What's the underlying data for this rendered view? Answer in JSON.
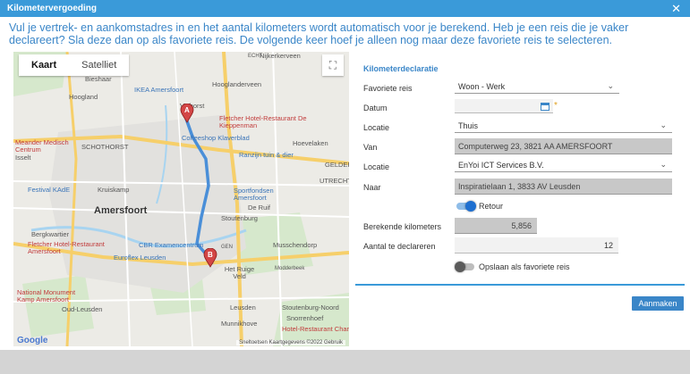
{
  "window": {
    "title": "Kilometervergoeding",
    "close_glyph": "✕"
  },
  "intro": "Vul je vertrek- en aankomstadres in en het aantal kilometers wordt automatisch voor je berekend. Heb je een reis die je vaker declareert? Sla deze dan op als favoriete reis. De volgende keer hoef je alleen nog maar deze favoriete reis te selecteren.",
  "map": {
    "tabs": [
      "Kaart",
      "Satelliet"
    ],
    "fullscreen_glyph": "⛶",
    "labels": {
      "nijkerkerveen": "Nijkerkerveen",
      "bieshaar": "Bieshaar",
      "hoogland": "Hoogland",
      "ikea": "IKEA Amersfoort",
      "hooglanderveen": "Hooglanderveen",
      "vathorst": "Vathorst",
      "fletcher1": "Fletcher Hotel-Restaurant De Kieppenman",
      "coffeeshop": "Coffeeshop Klaverblad",
      "hoevelaken": "Hoevelaken",
      "meander": "Meander Medisch Centrum",
      "schothorst": "SCHOTHORST",
      "ranzijn": "Ranzijn tuin & dier",
      "isselt": "Isselt",
      "gelderl": "GELDERL",
      "kruiskamp": "Kruiskamp",
      "festival": "Festival KAdE",
      "sportfondsen": "Sportfondsen Amersfoort",
      "utrecht": "UTRECHT",
      "amersfoort": "Amersfoort",
      "deruif": "De Ruif",
      "stoutenburg": "Stoutenburg",
      "bergkwartier": "Bergkwartier",
      "cbr": "CBR Examencentrum",
      "musschendorp": "Musschendorp",
      "fletcher2": "Fletcher Hotel-Restaurant Amersfoort",
      "euroflex": "Euroflex Leusden",
      "modderbeek": "Modderbeek",
      "hetruigeveld": "Het Ruige Veld",
      "national": "National Monument Kamp Amersfoort",
      "oudleusden": "Oud-Leusden",
      "leusden": "Leusden",
      "stoutenburgnoord": "Stoutenburg-Noord",
      "munnikhove": "Munnikhove",
      "snorrenhoef": "Snorrenhoef",
      "hotelchard": "Hotel-Restaurant Chard",
      "echt": "ECHT",
      "gen": "GEN"
    },
    "marker_a": "A",
    "marker_b": "B",
    "google": "Google",
    "copyright": "Sneltoetsen   Kaartgegevens ©2022   Gebruik",
    "colors": {
      "route": "#4a8fd8",
      "highway": "#f6cf6a",
      "water": "#a8d4f0",
      "park": "#cfe6c4"
    }
  },
  "form": {
    "section_title": "Kilometerdeclaratie",
    "favoriete_reis": {
      "label": "Favoriete reis",
      "value": "Woon - Werk"
    },
    "datum": {
      "label": "Datum",
      "value": "",
      "required": "*"
    },
    "locatie_van": {
      "label": "Locatie",
      "value": "Thuis"
    },
    "van": {
      "label": "Van",
      "value": "Computerweg 23, 3821 AA  AMERSFOORT"
    },
    "locatie_naar": {
      "label": "Locatie",
      "value": "EnYoi ICT Services B.V."
    },
    "naar": {
      "label": "Naar",
      "value": "Inspiratielaan 1, 3833 AV  Leusden"
    },
    "retour": {
      "label": "Retour",
      "on": true
    },
    "berekende_km": {
      "label": "Berekende kilometers",
      "value": "5,856"
    },
    "aantal": {
      "label": "Aantal te declareren",
      "value": "12"
    },
    "favoriet_opslaan": {
      "label": "Opslaan als favoriete reis",
      "on": false
    },
    "submit": "Aanmaken"
  }
}
